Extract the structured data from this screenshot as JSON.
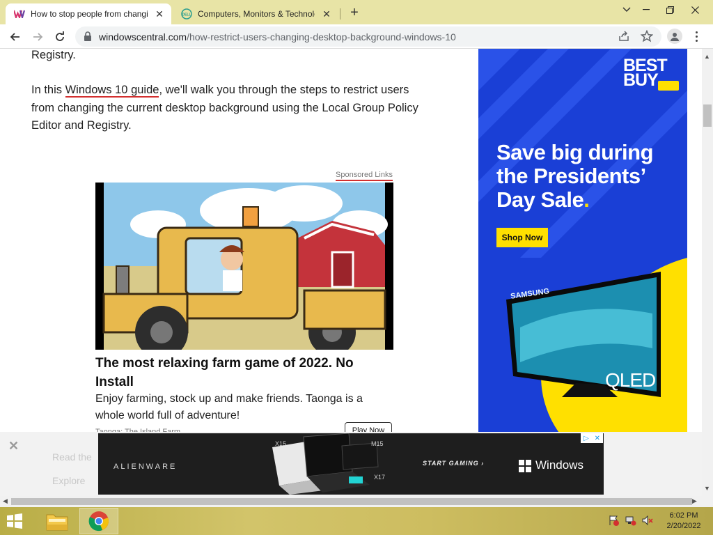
{
  "browser": {
    "tabs": [
      {
        "title": "How to stop people from changi",
        "active": true,
        "icon": "windows-central-icon"
      },
      {
        "title": "Computers, Monitors & Technolo",
        "active": false,
        "icon": "dell-icon"
      }
    ],
    "new_tab_label": "+",
    "url_domain": "windowscentral.com",
    "url_path": "/how-restrict-users-changing-desktop-background-windows-10"
  },
  "article": {
    "registry_fragment": "Registry.",
    "intro_prefix": "In this ",
    "intro_link": "Windows 10 guide",
    "intro_rest_1": ", we'll walk you through the steps to restrict users",
    "intro_line_2": "from changing the current desktop background using the Local Group Policy",
    "intro_line_3": "Editor and Registry."
  },
  "sponsored": {
    "label": "Sponsored Links",
    "title": "The most relaxing farm game of 2022. No Install",
    "description": "Enjoy farming, stock up and make friends. Taonga is a whole world full of adventure!",
    "source": "Taonga: The Island Farm",
    "button": "Play Now"
  },
  "side_ad": {
    "brand_line1": "BEST",
    "brand_line2": "BUY",
    "headline": "Save big during the Presidents’ Day Sale",
    "headline_dot": ".",
    "cta": "Shop Now",
    "tv_brand": "SAMSUNG",
    "tv_model": "QLED",
    "brand_color": "#1a3fd6",
    "accent_color": "#ffe000"
  },
  "bottom_ad": {
    "brand": "ALIENWARE",
    "cta": "START GAMING ›",
    "partner": "Windows",
    "models": [
      "X15",
      "M15",
      "X17"
    ],
    "ghost_1": "Read the",
    "ghost_2": "Explore"
  },
  "taskbar": {
    "time": "6:02 PM",
    "date": "2/20/2022"
  }
}
